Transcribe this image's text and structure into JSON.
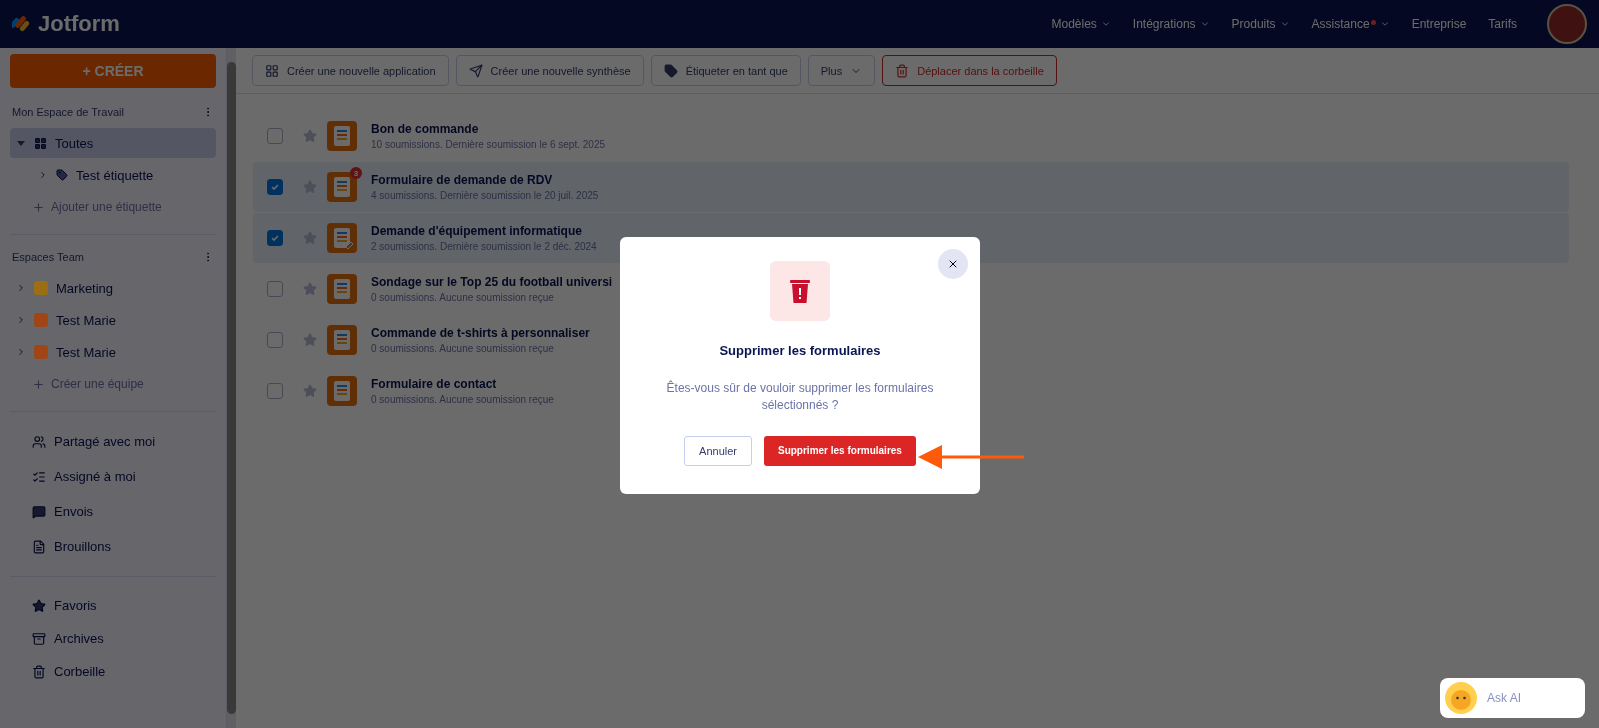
{
  "header": {
    "logo": "Jotform",
    "nav": [
      {
        "label": "Modèles",
        "caret": true,
        "dot": false
      },
      {
        "label": "Intégrations",
        "caret": true,
        "dot": false
      },
      {
        "label": "Produits",
        "caret": true,
        "dot": false
      },
      {
        "label": "Assistance",
        "caret": true,
        "dot": true
      },
      {
        "label": "Entreprise",
        "caret": false,
        "dot": false
      },
      {
        "label": "Tarifs",
        "caret": false,
        "dot": false
      }
    ]
  },
  "create_button": "+ CRÉER",
  "toolbar": [
    {
      "kind": "app",
      "label": "Créer une nouvelle application"
    },
    {
      "kind": "synthesis",
      "label": "Créer une nouvelle synthèse"
    },
    {
      "kind": "tag",
      "label": "Étiqueter en tant que"
    },
    {
      "kind": "more",
      "label": "Plus"
    },
    {
      "kind": "trash",
      "label": "Déplacer dans la corbeille"
    }
  ],
  "sidebar": {
    "workspace_title": "Mon Espace de Travail",
    "folders": [
      {
        "label": "Toutes",
        "selected": true,
        "expanded": true,
        "children": [
          {
            "label": "Test étiquette",
            "selected": false,
            "expanded": false
          }
        ]
      }
    ],
    "add_label": "Ajouter une étiquette",
    "team_title": "Espaces Team",
    "teams": [
      {
        "label": "Marketing",
        "color": "#9c6e14"
      },
      {
        "label": "Test Marie",
        "color": "#a04516"
      },
      {
        "label": "Test Marie",
        "color": "#a04516"
      }
    ],
    "create_team": "Créer une équipe",
    "links": [
      {
        "kind": "shared",
        "label": "Partagé avec moi"
      },
      {
        "kind": "assigned",
        "label": "Assigné à moi"
      },
      {
        "kind": "sent",
        "label": "Envois"
      },
      {
        "kind": "drafts",
        "label": "Brouillons"
      }
    ],
    "links_2": [
      {
        "kind": "favorites",
        "label": "Favoris"
      },
      {
        "kind": "archive",
        "label": "Archives"
      },
      {
        "kind": "trash",
        "label": "Corbeille"
      }
    ]
  },
  "forms": [
    {
      "title": "Bon de commande",
      "subtitle": "10 soumissions. Dernière soumission le 6 sept. 2025",
      "checked": false,
      "kind": "form"
    },
    {
      "title": "Formulaire de demande de RDV",
      "subtitle": "4 soumissions. Dernière soumission le 20 juil. 2025",
      "checked": true,
      "kind": "form",
      "badge": "3"
    },
    {
      "title": "Demande d'équipement informatique",
      "subtitle": "2 soumissions. Dernière soumission le 2 déc. 2024",
      "checked": true,
      "kind": "sign"
    },
    {
      "title": "Sondage sur le Top 25 du football universi",
      "subtitle": "0 soumissions. Aucune soumission reçue",
      "checked": false,
      "kind": "form"
    },
    {
      "title": "Commande de t-shirts à personnaliser",
      "subtitle": "0 soumissions. Aucune soumission reçue",
      "checked": false,
      "kind": "form"
    },
    {
      "title": "Formulaire de contact",
      "subtitle": "0 soumissions. Aucune soumission reçue",
      "checked": false,
      "kind": "form"
    }
  ],
  "modal": {
    "title": "Supprimer les formulaires",
    "message": "Êtes-vous sûr de vouloir supprimer les formulaires sélectionnés ?",
    "cancel": "Annuler",
    "confirm": "Supprimer les formulaires"
  },
  "ask_ai": "Ask AI"
}
